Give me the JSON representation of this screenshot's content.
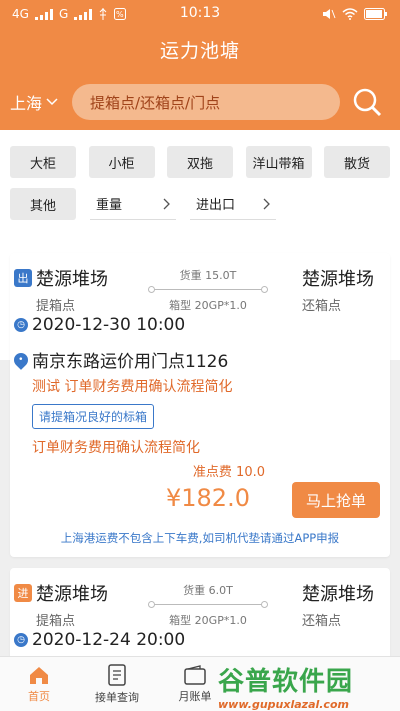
{
  "status": {
    "left": "4G",
    "time": "10:13"
  },
  "header": {
    "title": "运力池塘",
    "city": "上海",
    "search_placeholder": "提箱点/还箱点/门点"
  },
  "filters": {
    "chips": [
      "大柜",
      "小柜",
      "双拖",
      "洋山带箱",
      "散货"
    ],
    "other_chip": "其他",
    "selects": [
      "重量",
      "进出口"
    ]
  },
  "orders": [
    {
      "tag": "出",
      "from_name": "楚源堆场",
      "from_sub": "提箱点",
      "to_name": "楚源堆场",
      "to_sub": "还箱点",
      "weight": "货重  15.0T",
      "box": "箱型  20GP*1.0",
      "datetime": "2020-12-30 10:00",
      "store": "南京东路运价用门点1126",
      "note1": "测试 订单财务费用确认流程简化",
      "badge": "请提箱况良好的标箱",
      "note2": "订单财务费用确认流程简化",
      "fee": "准点费 10.0",
      "price": "¥182.0",
      "grab": "马上抢单",
      "notice": "上海港运费不包含上下车费,如司机代垫请通过APP申报"
    },
    {
      "tag": "进",
      "from_name": "楚源堆场",
      "from_sub": "提箱点",
      "to_name": "楚源堆场",
      "to_sub": "还箱点",
      "weight": "货重  6.0T",
      "box": "箱型  20GP*1.0",
      "datetime": "2020-12-24 20:00"
    }
  ],
  "tabs": [
    {
      "label": "首页"
    },
    {
      "label": "接单查询"
    },
    {
      "label": "月账单"
    }
  ],
  "watermark": {
    "big": "谷普软件园",
    "small": "www.gupuxlazal.com"
  }
}
